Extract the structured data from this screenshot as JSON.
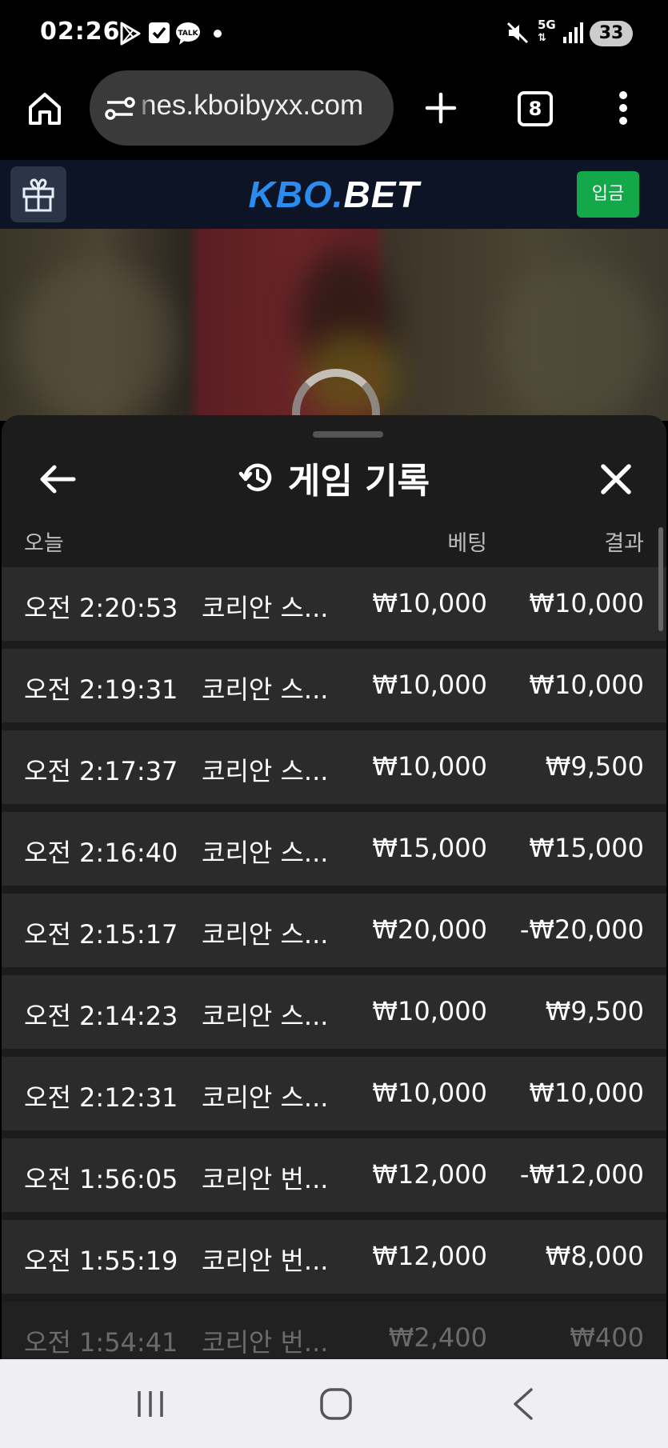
{
  "status_bar": {
    "time": "02:26",
    "network": "5G",
    "battery": "33"
  },
  "browser": {
    "url": "nes.kboibyxx.com",
    "tab_count": "8"
  },
  "site_header": {
    "logo_part1": "KBO.",
    "logo_part2": "BET",
    "deposit_label": "입금"
  },
  "sheet": {
    "title": "게임 기록",
    "columns": {
      "today": "오늘",
      "bet": "베팅",
      "result": "결과"
    },
    "rows": [
      {
        "time": "오전 2:20:53",
        "game": "코리안 스...",
        "bet": "₩10,000",
        "result": "₩10,000"
      },
      {
        "time": "오전 2:19:31",
        "game": "코리안 스...",
        "bet": "₩10,000",
        "result": "₩10,000"
      },
      {
        "time": "오전 2:17:37",
        "game": "코리안 스...",
        "bet": "₩10,000",
        "result": "₩9,500"
      },
      {
        "time": "오전 2:16:40",
        "game": "코리안 스...",
        "bet": "₩15,000",
        "result": "₩15,000"
      },
      {
        "time": "오전 2:15:17",
        "game": "코리안 스...",
        "bet": "₩20,000",
        "result": "-₩20,000"
      },
      {
        "time": "오전 2:14:23",
        "game": "코리안 스...",
        "bet": "₩10,000",
        "result": "₩9,500"
      },
      {
        "time": "오전 2:12:31",
        "game": "코리안 스...",
        "bet": "₩10,000",
        "result": "₩10,000"
      },
      {
        "time": "오전 1:56:05",
        "game": "코리안 번...",
        "bet": "₩12,000",
        "result": "-₩12,000"
      },
      {
        "time": "오전 1:55:19",
        "game": "코리안 번...",
        "bet": "₩12,000",
        "result": "₩8,000"
      },
      {
        "time": "오전 1:54:41",
        "game": "코리안 번...",
        "bet": "₩2,400",
        "result": "₩400"
      }
    ]
  },
  "colors": {
    "sheet_bg": "#1c1c1c",
    "row_bg": "#2b2b2b",
    "deposit_green": "#13a84a",
    "logo_blue": "#2b8cf0"
  },
  "icons": {
    "home": "home-icon",
    "site_settings": "site-settings-icon",
    "new_tab": "plus-icon",
    "menu": "more-vert-icon",
    "gift": "gift-icon",
    "back": "arrow-left-icon",
    "history": "history-icon",
    "close": "close-icon"
  }
}
